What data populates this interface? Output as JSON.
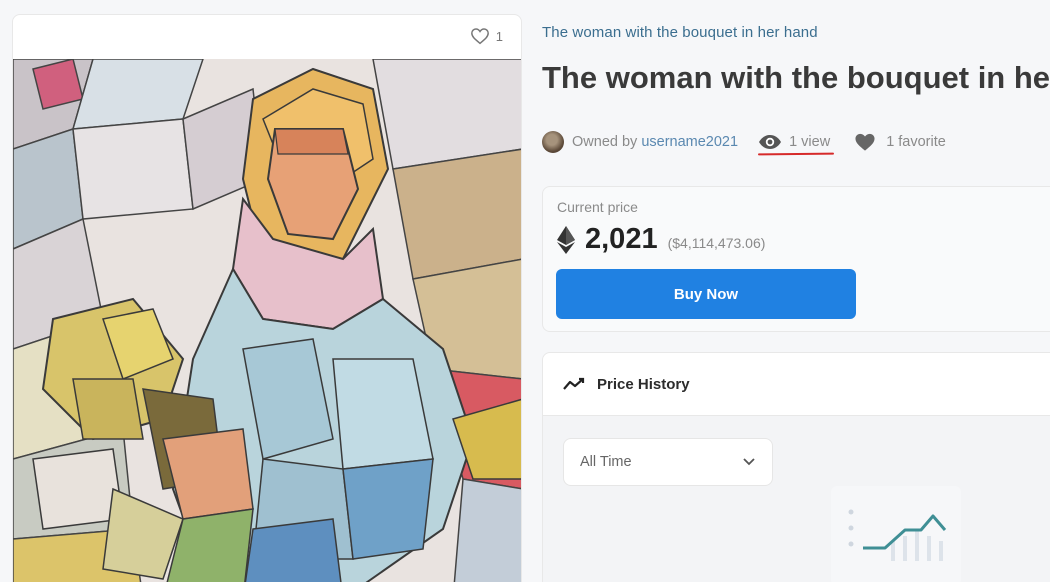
{
  "artwork": {
    "favorite_count": "1"
  },
  "item": {
    "collection_name": "The woman with the bouquet in her hand",
    "title": "The woman with the bouquet in her h",
    "owned_by_label": "Owned by",
    "owner": "username2021",
    "views": "1 view",
    "favorites": "1 favorite"
  },
  "price": {
    "label": "Current price",
    "amount": "2,021",
    "usd": "($4,114,473.06)",
    "buy_label": "Buy Now"
  },
  "history": {
    "title": "Price History",
    "period": "All Time"
  },
  "colors": {
    "accent": "#2081e2",
    "link": "#3b6e8f",
    "annotation": "#d62a2a"
  },
  "icons": [
    "heart-outline-icon",
    "eye-icon",
    "heart-icon",
    "ethereum-icon",
    "trend-line-icon",
    "chevron-down-icon"
  ]
}
